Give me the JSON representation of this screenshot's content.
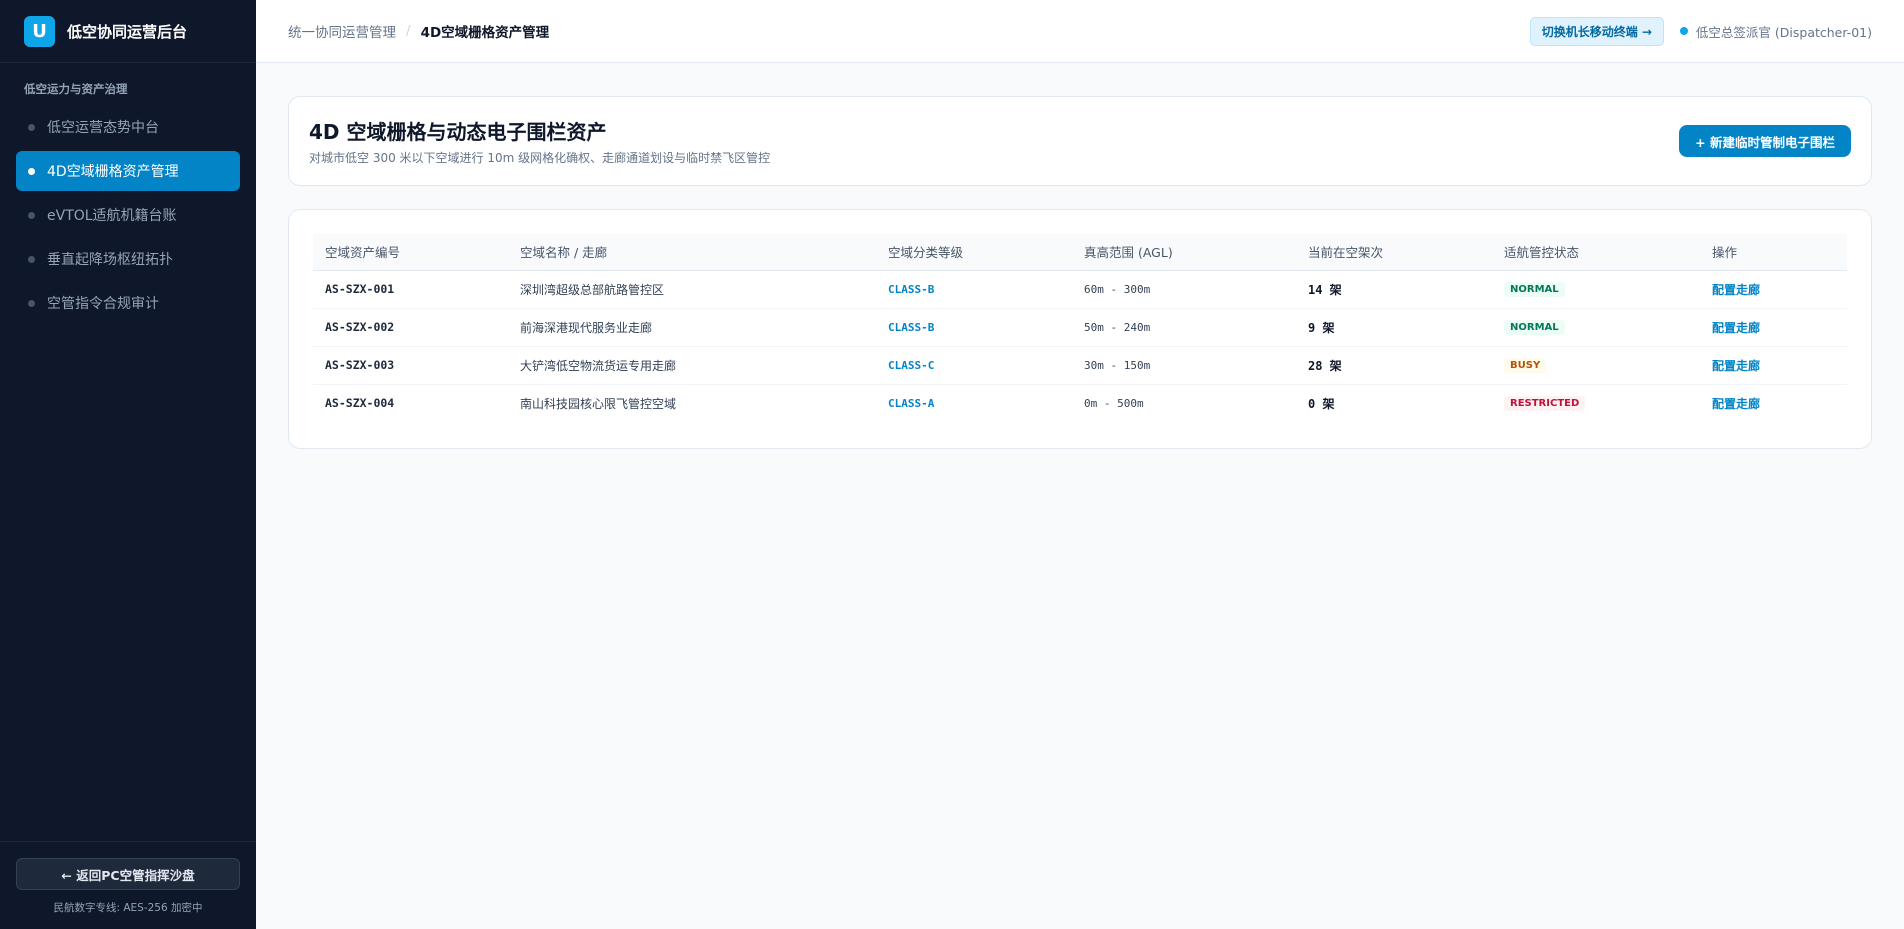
{
  "sidebar": {
    "logo_letter": "U",
    "brand_title": "低空协同运营后台",
    "section_label": "低空运力与资产治理",
    "items": [
      {
        "label": "低空运营态势中台"
      },
      {
        "label": "4D空域栅格资产管理"
      },
      {
        "label": "eVTOL适航机籍台账"
      },
      {
        "label": "垂直起降场枢纽拓扑"
      },
      {
        "label": "空管指令合规审计"
      }
    ],
    "back_label": "← 返回PC空管指挥沙盘",
    "footer_note": "民航数字专线: AES-256 加密中"
  },
  "header": {
    "breadcrumb_parent": "统一协同运营管理",
    "breadcrumb_sep": "/",
    "breadcrumb_current": "4D空域栅格资产管理",
    "switch_label": "切换机长移动终端 →",
    "user_label": "低空总签派官 (Dispatcher-01)"
  },
  "page": {
    "title": "4D 空域栅格与动态电子围栏资产",
    "subtitle": "对城市低空 300 米以下空域进行 10m 级网格化确权、走廊通道划设与临时禁飞区管控",
    "new_button": "+ 新建临时管制电子围栏"
  },
  "table": {
    "columns": [
      "空域资产编号",
      "空域名称 / 走廊",
      "空域分类等级",
      "真高范围 (AGL)",
      "当前在空架次",
      "适航管控状态",
      "操作"
    ],
    "rows": [
      {
        "id": "AS-SZX-001",
        "name": "深圳湾超级总部航路管控区",
        "class": "CLASS-B",
        "range": "60m - 300m",
        "count": "14 架",
        "status": "NORMAL",
        "action": "配置走廊"
      },
      {
        "id": "AS-SZX-002",
        "name": "前海深港现代服务业走廊",
        "class": "CLASS-B",
        "range": "50m - 240m",
        "count": "9 架",
        "status": "NORMAL",
        "action": "配置走廊"
      },
      {
        "id": "AS-SZX-003",
        "name": "大铲湾低空物流货运专用走廊",
        "class": "CLASS-C",
        "range": "30m - 150m",
        "count": "28 架",
        "status": "BUSY",
        "action": "配置走廊"
      },
      {
        "id": "AS-SZX-004",
        "name": "南山科技园核心限飞管控空域",
        "class": "CLASS-A",
        "range": "0m - 500m",
        "count": "0 架",
        "status": "RESTRICTED",
        "action": "配置走廊"
      }
    ]
  },
  "colors": {
    "sidebar_bg": "#0f172a",
    "accent": "#0284c7",
    "normal": "#047857",
    "busy": "#b45309",
    "restricted": "#be123c"
  }
}
